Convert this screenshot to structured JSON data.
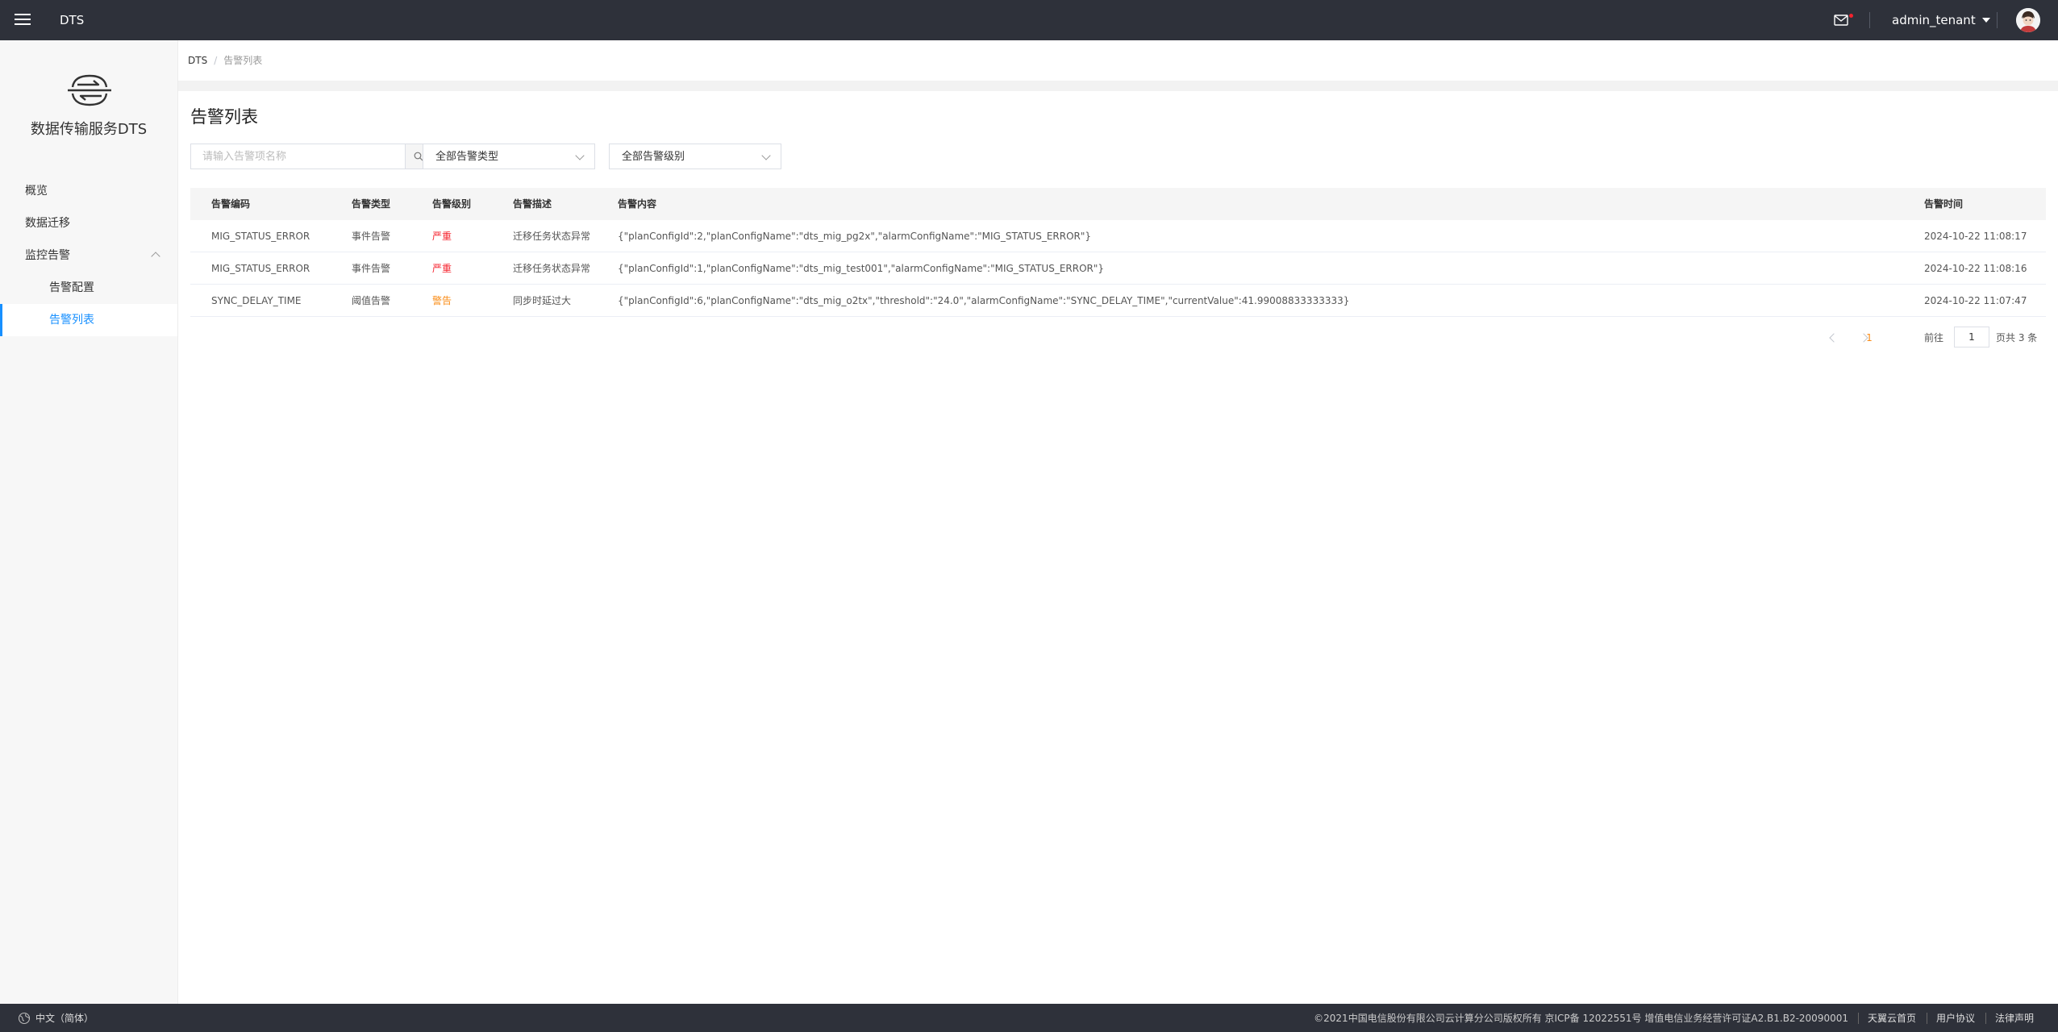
{
  "topbar": {
    "menu_icon": "hamburger-menu-icon",
    "app_name": "DTS",
    "user": "admin_tenant",
    "mail_icon": "mail-icon",
    "notification_dot_color": "#f5222d"
  },
  "sidebar": {
    "title": "数据传输服务DTS",
    "items": [
      {
        "label": "概览"
      },
      {
        "label": "数据迁移"
      },
      {
        "label": "监控告警",
        "expanded": true
      },
      {
        "label": "告警配置"
      },
      {
        "label": "告警列表",
        "active": true
      }
    ],
    "accent_color": "#1890ff"
  },
  "breadcrumb": {
    "root": "DTS",
    "separator": "/",
    "current": "告警列表"
  },
  "page": {
    "title": "告警列表"
  },
  "filters": {
    "search_placeholder": "请输入告警项名称",
    "type_select": "全部告警类型",
    "level_select": "全部告警级别"
  },
  "table": {
    "headers": [
      "告警编码",
      "告警类型",
      "告警级别",
      "告警描述",
      "告警内容",
      "告警时间"
    ],
    "rows": [
      {
        "code": "MIG_STATUS_ERROR",
        "type": "事件告警",
        "level": "严重",
        "desc": "迁移任务状态异常",
        "content": "{\"planConfigId\":2,\"planConfigName\":\"dts_mig_pg2x\",\"alarmConfigName\":\"MIG_STATUS_ERROR\"}",
        "time": "2024-10-22 11:08:17"
      },
      {
        "code": "MIG_STATUS_ERROR",
        "type": "事件告警",
        "level": "严重",
        "desc": "迁移任务状态异常",
        "content": "{\"planConfigId\":1,\"planConfigName\":\"dts_mig_test001\",\"alarmConfigName\":\"MIG_STATUS_ERROR\"}",
        "time": "2024-10-22 11:08:16"
      },
      {
        "code": "SYNC_DELAY_TIME",
        "type": "阈值告警",
        "level": "警告",
        "desc": "同步时延过大",
        "content": "{\"planConfigId\":6,\"planConfigName\":\"dts_mig_o2tx\",\"threshold\":\"24.0\",\"alarmConfigName\":\"SYNC_DELAY_TIME\",\"currentValue\":41.99008833333333}",
        "time": "2024-10-22 11:07:47"
      }
    ],
    "level_colors": {
      "严重": "#f5222d",
      "警告": "#fa8c16"
    }
  },
  "pagination": {
    "current_page": "1",
    "goto_label": "前往",
    "goto_value": "1",
    "total_text": "页共 3 条"
  },
  "footer": {
    "language": "中文（简体）",
    "copyright": "©2021中国电信股份有限公司云计算分公司版权所有 京ICP备 12022551号 增值电信业务经营许可证A2.B1.B2-20090001",
    "links": [
      "天翼云首页",
      "用户协议",
      "法律声明"
    ]
  }
}
